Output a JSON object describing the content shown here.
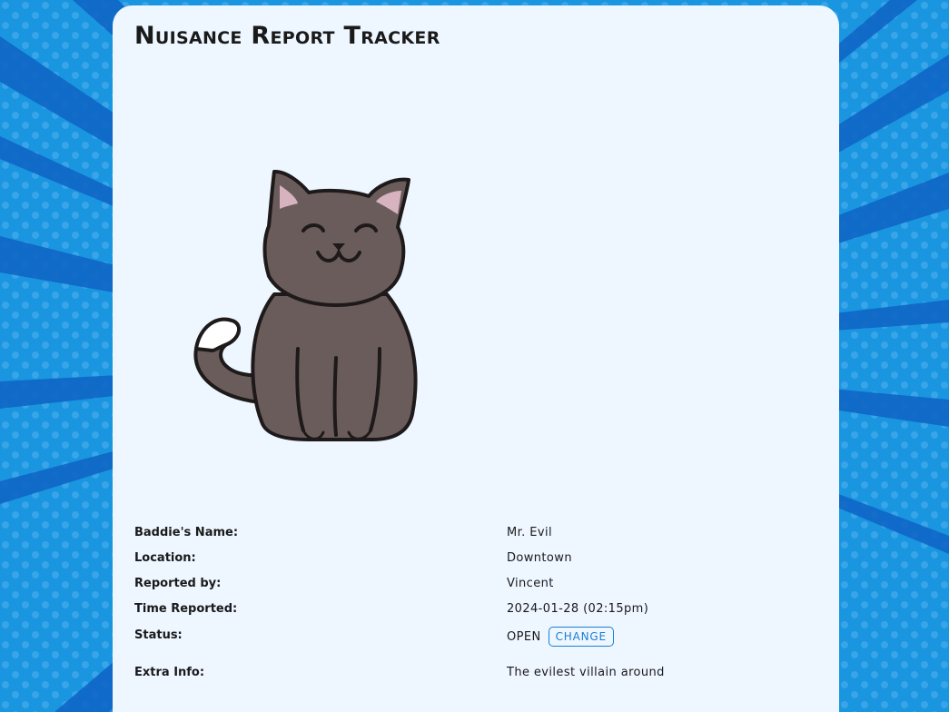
{
  "app": {
    "title": "Nuisance Report Tracker"
  },
  "colors": {
    "background": "#1a95e0",
    "card": "#eef6ff",
    "accent": "#1a7fd4"
  },
  "image": {
    "icon": "cat-illustration"
  },
  "report": {
    "name_label": "Baddie's Name:",
    "name_value": "Mr. Evil",
    "location_label": "Location:",
    "location_value": "Downtown",
    "reported_by_label": "Reported by:",
    "reported_by_value": "Vincent",
    "time_label": "Time Reported:",
    "time_value": "2024-01-28 (02:15pm)",
    "status_label": "Status:",
    "status_value": "OPEN",
    "change_label": "CHANGE",
    "extra_label": "Extra Info:",
    "extra_value": "The evilest villain around"
  }
}
